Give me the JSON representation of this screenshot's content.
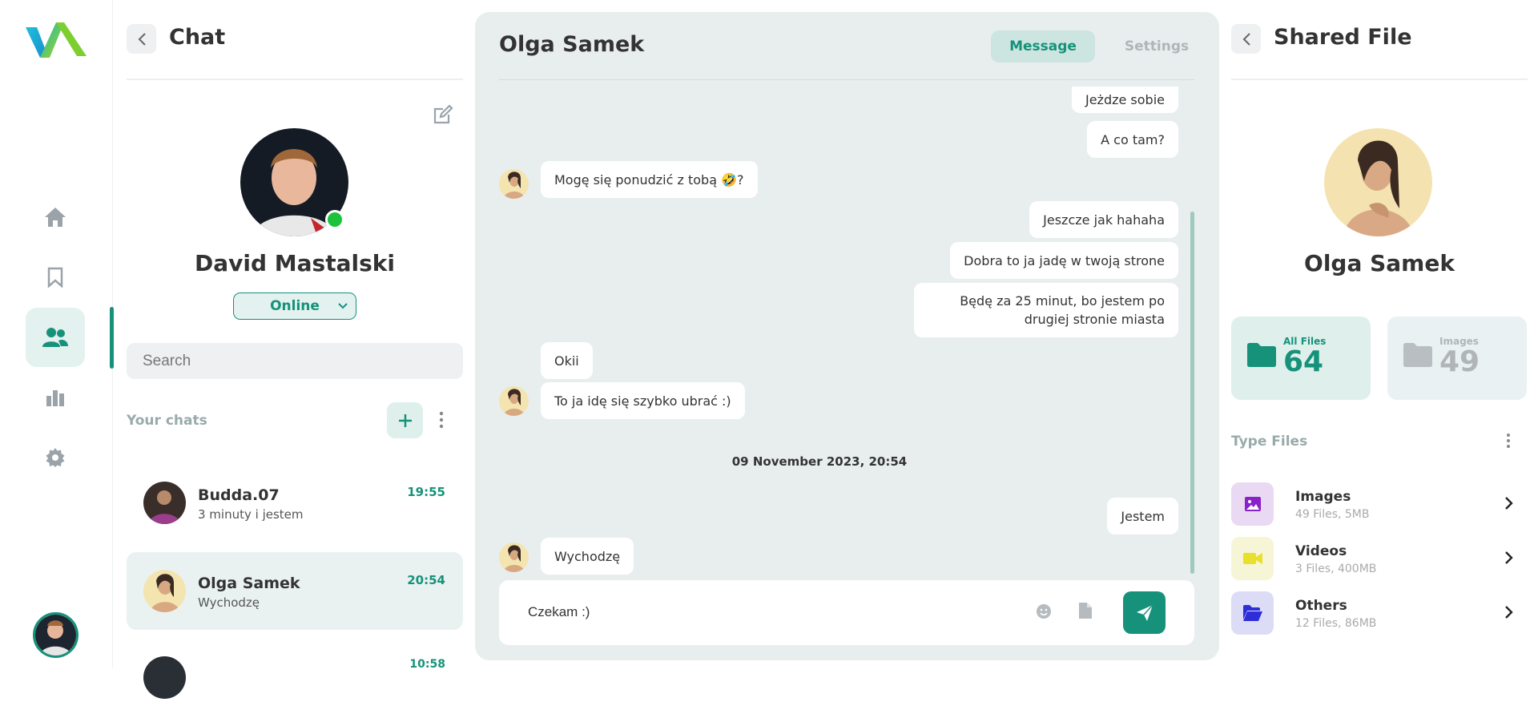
{
  "nav": {
    "items": [
      {
        "icon": "home-icon"
      },
      {
        "icon": "bookmark-icon"
      },
      {
        "icon": "users-icon",
        "active": true
      },
      {
        "icon": "bar-chart-icon"
      },
      {
        "icon": "gear-icon"
      }
    ],
    "accent": "#16927a"
  },
  "chat_panel": {
    "title": "Chat",
    "profile": {
      "name": "David Mastalski",
      "status": "Online"
    },
    "search_placeholder": "Search",
    "section_label": "Your chats",
    "chats": [
      {
        "name": "Budda.07",
        "last_message": "3 minuty i jestem",
        "time": "19:55"
      },
      {
        "name": "Olga Samek",
        "last_message": "Wychodzę",
        "time": "20:54",
        "active": true
      },
      {
        "name": "",
        "last_message": "",
        "time": "10:58"
      }
    ]
  },
  "conversation": {
    "contact_name": "Olga Samek",
    "tabs": {
      "message": "Message",
      "settings": "Settings"
    },
    "messages": [
      {
        "text": "Jeżdze sobie",
        "direction": "out"
      },
      {
        "text": "A co tam?",
        "direction": "out"
      },
      {
        "text": "Mogę się ponudzić z tobą 🤣?",
        "direction": "in"
      },
      {
        "text": "Jeszcze jak hahaha",
        "direction": "out"
      },
      {
        "text": "Dobra to ja jadę w twoją strone",
        "direction": "out"
      },
      {
        "text": "Będę za 25 minut, bo jestem po drugiej stronie miasta",
        "direction": "out"
      },
      {
        "text": "Okii",
        "direction": "in"
      },
      {
        "text": "To ja idę się szybko ubrać :)",
        "direction": "in"
      },
      {
        "text": "Jestem",
        "direction": "out"
      },
      {
        "text": "Wychodzę",
        "direction": "in"
      }
    ],
    "date_divider": "09 November 2023, 20:54",
    "composer_value": "Czekam :)"
  },
  "shared_panel": {
    "title": "Shared File",
    "contact_name": "Olga Samek",
    "cards": {
      "all_files": {
        "label": "All Files",
        "count": "64"
      },
      "images": {
        "label": "Images",
        "count": "49"
      }
    },
    "section_label": "Type Files",
    "file_types": [
      {
        "name": "Images",
        "details": "49 Files, 5MB",
        "icon": "image-icon",
        "color": "#8a22c9"
      },
      {
        "name": "Videos",
        "details": "3 Files, 400MB",
        "icon": "video-icon",
        "color": "#e8e02a"
      },
      {
        "name": "Others",
        "details": "12 Files, 86MB",
        "icon": "folder-open-icon",
        "color": "#2e2ed8"
      }
    ]
  }
}
